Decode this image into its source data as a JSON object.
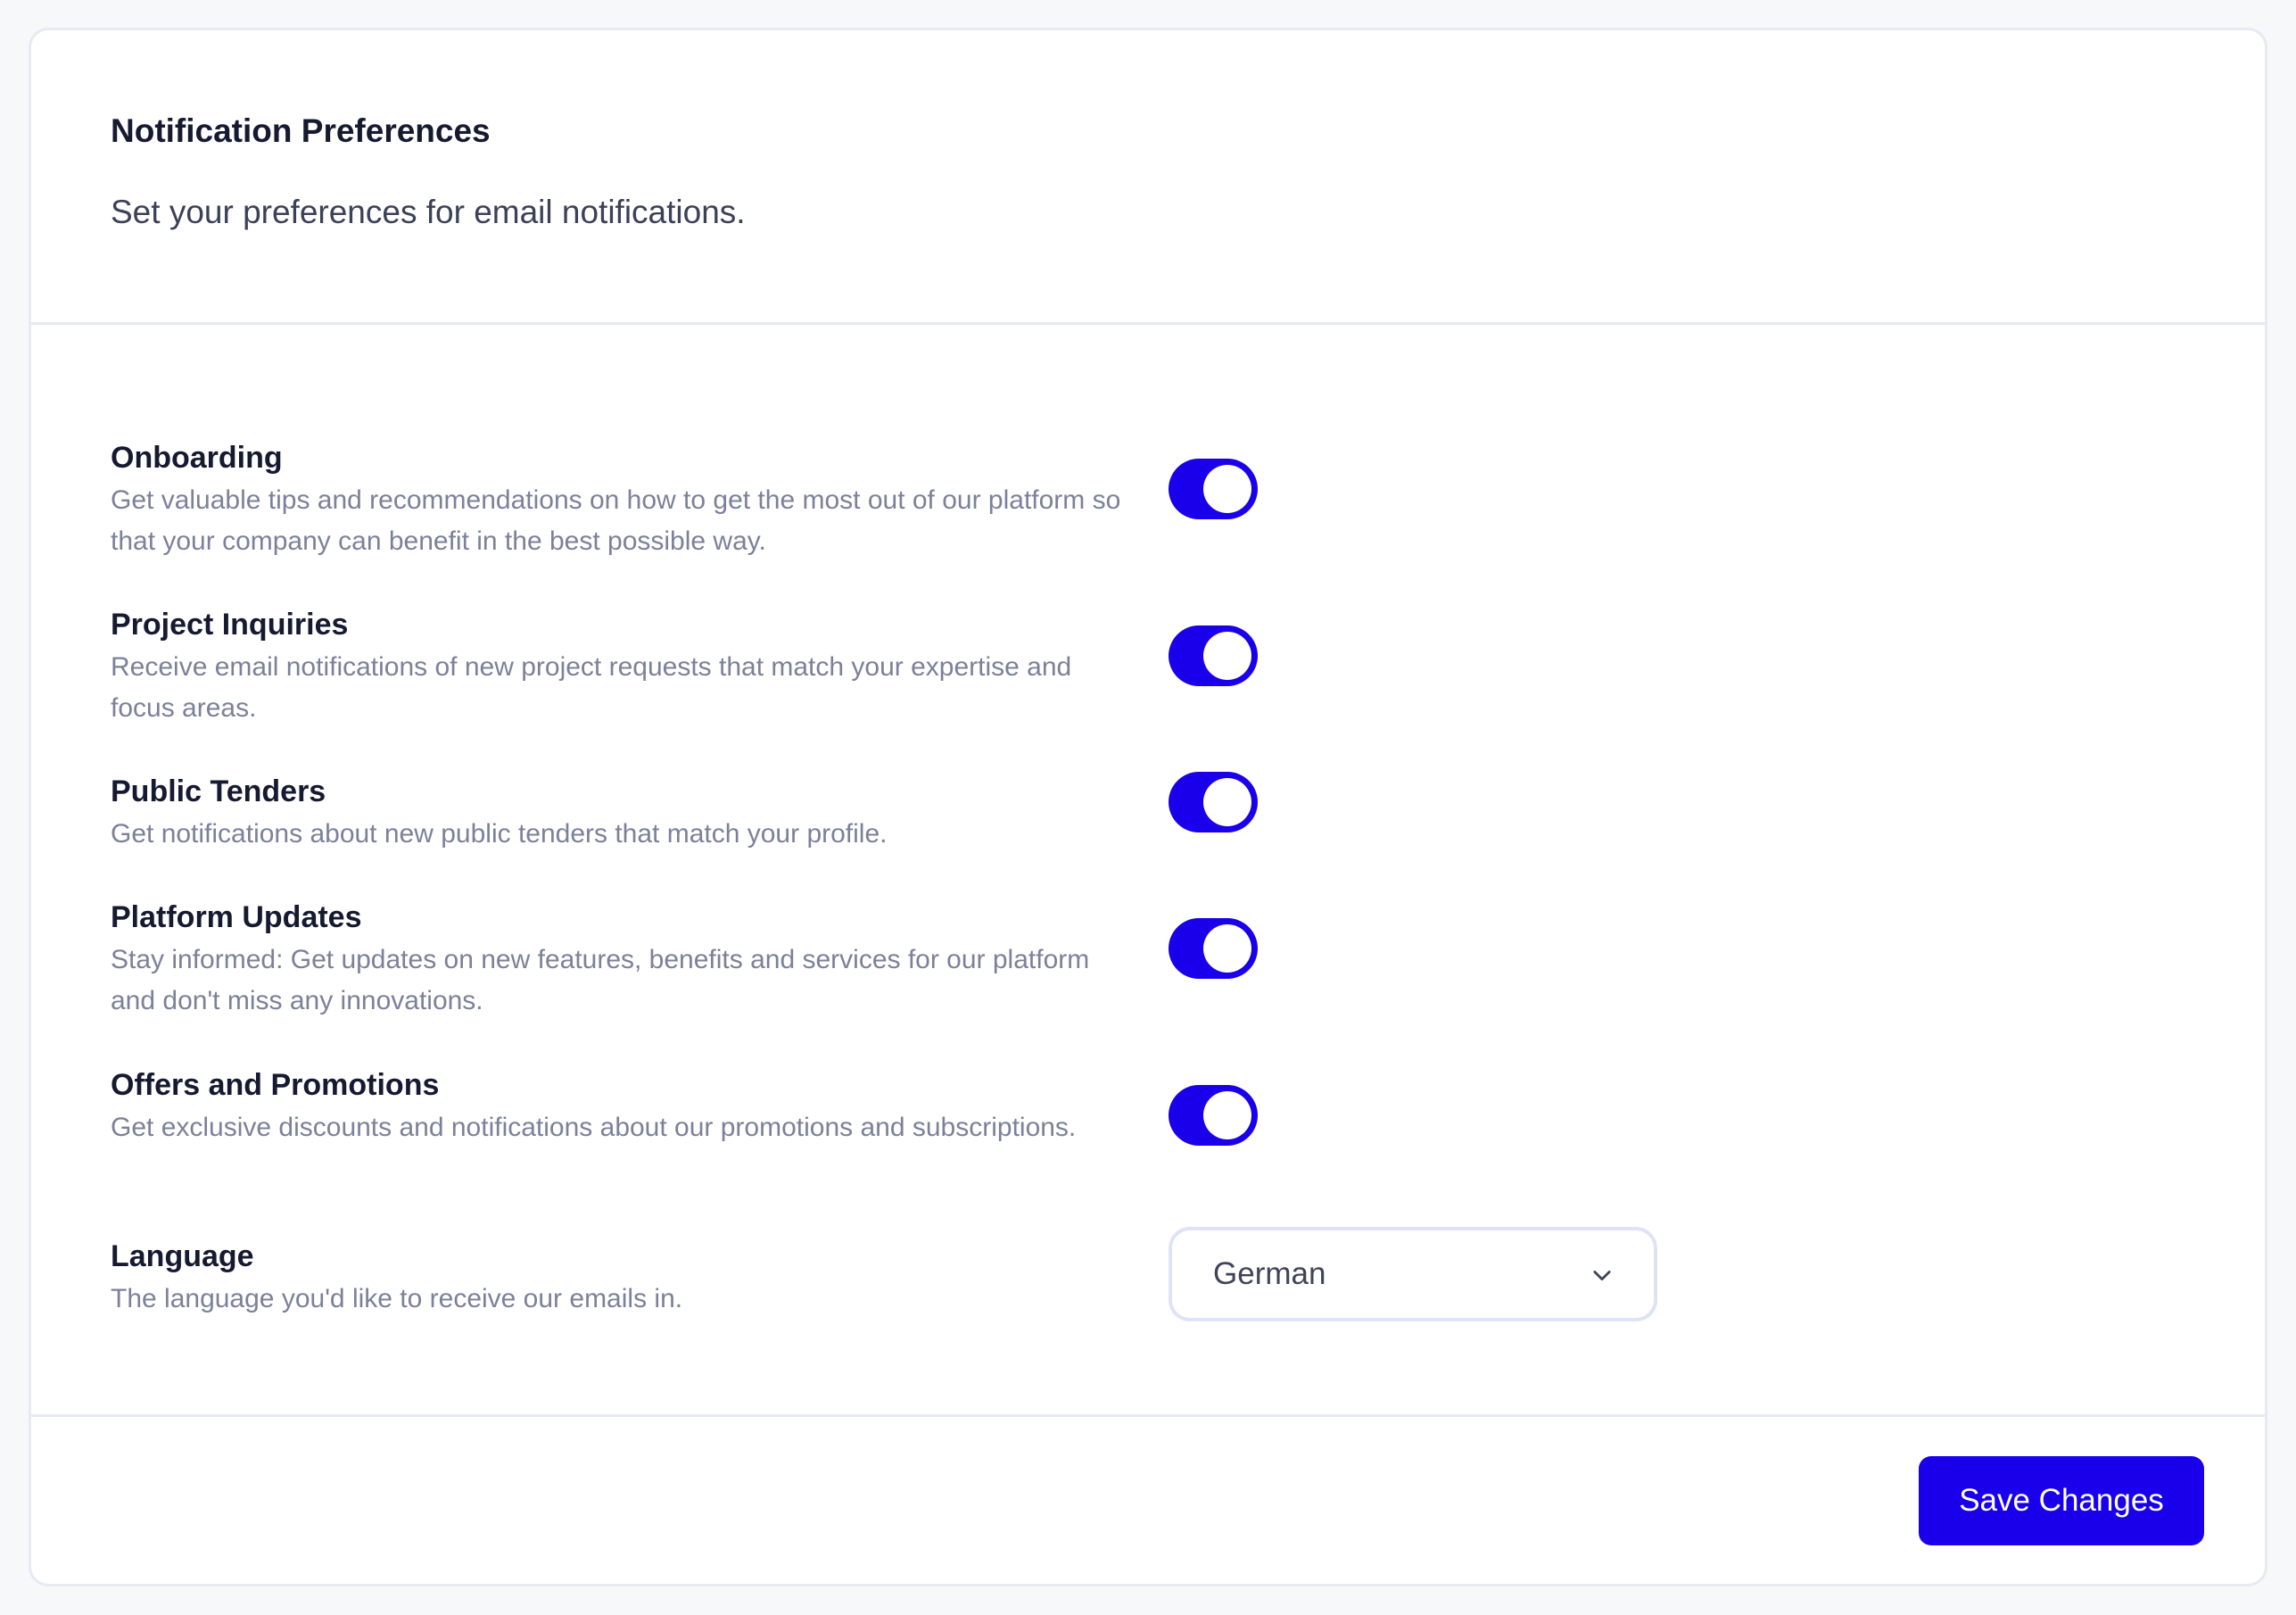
{
  "header": {
    "title": "Notification Preferences",
    "subtitle": "Set your preferences for email notifications."
  },
  "settings": [
    {
      "title": "Onboarding",
      "description": "Get valuable tips and recommendations on how to get the most out of our platform so that your company can benefit in the best possible way.",
      "enabled": true
    },
    {
      "title": "Project Inquiries",
      "description": "Receive email notifications of new project requests that match your expertise and focus areas.",
      "enabled": true
    },
    {
      "title": "Public Tenders",
      "description": "Get notifications about new public tenders that match your profile.",
      "enabled": true
    },
    {
      "title": "Platform Updates",
      "description": "Stay informed: Get updates on new features, benefits and services for our platform and don't miss any innovations.",
      "enabled": true
    },
    {
      "title": "Offers and Promotions",
      "description": "Get exclusive discounts and notifications about our promotions and subscriptions.",
      "enabled": true
    }
  ],
  "language": {
    "title": "Language",
    "description": "The language you'd like to receive our emails in.",
    "selected": "German"
  },
  "footer": {
    "save_label": "Save Changes"
  },
  "colors": {
    "accent": "#1a00ea",
    "title_text": "#151a30",
    "muted_text": "#7b8199",
    "border": "#e8eaf2"
  },
  "icons": {
    "select_chevron": "chevron-down-icon"
  }
}
